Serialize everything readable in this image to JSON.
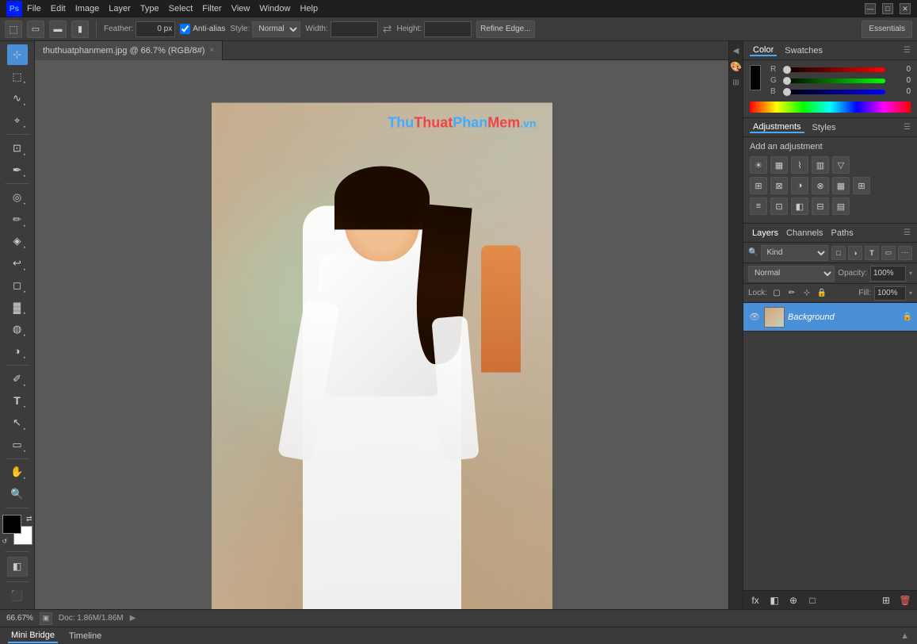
{
  "titlebar": {
    "logo": "PS",
    "menus": [
      "File",
      "Edit",
      "Image",
      "Layer",
      "Type",
      "Select",
      "Filter",
      "View",
      "Window",
      "Help"
    ],
    "winbtns": [
      "—",
      "□",
      "✕"
    ]
  },
  "toolbar": {
    "feather_label": "Feather:",
    "feather_value": "0 px",
    "antialias_label": "Anti-alias",
    "style_label": "Style:",
    "style_value": "Normal",
    "width_label": "Width:",
    "height_label": "Height:",
    "refine_edge_label": "Refine Edge...",
    "essentials_label": "Essentials"
  },
  "tab": {
    "filename": "thuthuatphanmem.jpg @ 66.7% (RGB/8#)",
    "close": "×"
  },
  "watermark": {
    "part1": "Thu",
    "part2": "Thuat",
    "part3": "Phan",
    "part4": "Mem",
    "part5": ".vn"
  },
  "color_panel": {
    "tab1": "Color",
    "tab2": "Swatches",
    "channels": [
      {
        "label": "R",
        "value": "0",
        "min": 0,
        "max": 255,
        "current": 0
      },
      {
        "label": "G",
        "value": "0",
        "min": 0,
        "max": 255,
        "current": 0
      },
      {
        "label": "B",
        "value": "0",
        "min": 0,
        "max": 255,
        "current": 0
      }
    ]
  },
  "adjustments_panel": {
    "tab1": "Adjustments",
    "tab2": "Styles",
    "title": "Add an adjustment",
    "icons": [
      "☀",
      "▦",
      "▤",
      "▨",
      "▽",
      "⊞",
      "⊠",
      "≋",
      "◑",
      "⊗",
      "▦",
      "⊞",
      "≡",
      "⊡",
      "◧",
      "⊟"
    ]
  },
  "layers_panel": {
    "tab1": "Layers",
    "tab2": "Channels",
    "tab3": "Paths",
    "search_placeholder": "Kind",
    "blend_mode": "Normal",
    "opacity_label": "Opacity:",
    "opacity_value": "100%",
    "lock_label": "Lock:",
    "fill_label": "Fill:",
    "fill_value": "100%",
    "layers": [
      {
        "name": "Background",
        "visible": true,
        "locked": true,
        "active": true
      }
    ],
    "footer_buttons": [
      "fx",
      "□",
      "⊞",
      "◧",
      "🗑"
    ]
  },
  "bottom_bar": {
    "zoom": "66.67%",
    "doc_info": "Doc: 1.86M/1.86M"
  },
  "mini_bridge": {
    "tab1": "Mini Bridge",
    "tab2": "Timeline"
  },
  "tools": [
    {
      "icon": "⊹",
      "name": "move-tool"
    },
    {
      "icon": "⬚",
      "name": "rectangular-marquee-tool"
    },
    {
      "icon": "◯",
      "name": "elliptical-marquee-tool"
    },
    {
      "icon": "✏",
      "name": "lasso-tool"
    },
    {
      "icon": "⌖",
      "name": "crop-tool"
    },
    {
      "icon": "⊘",
      "name": "eyedropper-tool"
    },
    {
      "icon": "✒",
      "name": "brush-tool"
    },
    {
      "icon": "◈",
      "name": "clone-stamp-tool"
    },
    {
      "icon": "↩",
      "name": "history-brush-tool"
    },
    {
      "icon": "◌",
      "name": "eraser-tool"
    },
    {
      "icon": "▓",
      "name": "gradient-tool"
    },
    {
      "icon": "◍",
      "name": "dodge-tool"
    },
    {
      "icon": "✐",
      "name": "pen-tool"
    },
    {
      "icon": "T",
      "name": "type-tool"
    },
    {
      "icon": "↖",
      "name": "path-selection-tool"
    },
    {
      "icon": "▭",
      "name": "rectangle-tool"
    },
    {
      "icon": "☞",
      "name": "hand-tool"
    },
    {
      "icon": "🔍",
      "name": "zoom-tool"
    }
  ]
}
